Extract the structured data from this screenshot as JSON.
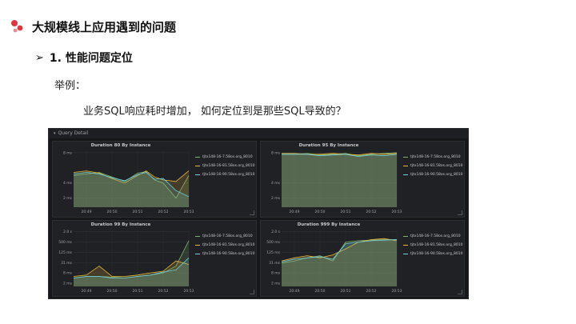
{
  "slide": {
    "title": "大规模线上应用遇到的问题",
    "bullet_arrow": "➢",
    "bullet": "1. 性能问题定位",
    "example_label": "举例：",
    "question": "业务SQL响应耗时增加， 如何定位到是那些SQL导致的？"
  },
  "dashboard": {
    "header_caret": "▾",
    "header": "Query Detail",
    "colors": {
      "series1": "#7eb26d",
      "series2": "#eab839",
      "series3": "#6ed0e0"
    }
  },
  "chart_data": [
    {
      "type": "area",
      "title": "Duration 80 By Instance",
      "y_ticks": [
        "8 ms",
        "4 ms",
        "2 ms"
      ],
      "x_ticks": [
        "20:49",
        "20:50",
        "20:51",
        "20:52",
        "20:53"
      ],
      "legend_entries": [
        "tjtx148-16-7.58os.org_8010",
        "tjtx148-16-81.58os.org_8010",
        "tjtx148-16-90.58os.org_8010"
      ],
      "series": [
        {
          "name": "tjtx148-16-7.58os.org_8010",
          "x": [
            "20:48:30",
            "20:49",
            "20:49:30",
            "20:50",
            "20:50:30",
            "20:51",
            "20:51:20",
            "20:51:40",
            "20:52",
            "20:52:30",
            "20:53"
          ],
          "values": [
            5.0,
            5.2,
            5.4,
            4.8,
            4.2,
            5.3,
            5.5,
            4.4,
            4.0,
            2.0,
            5.0
          ]
        },
        {
          "name": "tjtx148-16-81.58os.org_8010",
          "x": [
            "20:48:30",
            "20:49",
            "20:49:30",
            "20:50",
            "20:50:30",
            "20:51",
            "20:51:20",
            "20:51:40",
            "20:52",
            "20:52:30",
            "20:53"
          ],
          "values": [
            5.4,
            5.6,
            5.3,
            4.6,
            4.0,
            5.0,
            5.6,
            4.8,
            4.4,
            4.2,
            5.6
          ]
        },
        {
          "name": "tjtx148-16-90.58os.org_8010",
          "x": [
            "20:48:30",
            "20:49",
            "20:49:30",
            "20:50",
            "20:50:30",
            "20:51",
            "20:51:20",
            "20:51:40",
            "20:52",
            "20:52:30",
            "20:53"
          ],
          "values": [
            5.2,
            5.4,
            5.2,
            4.7,
            4.3,
            5.1,
            5.4,
            4.5,
            4.6,
            3.0,
            2.2
          ]
        }
      ]
    },
    {
      "type": "area",
      "title": "Duration 95 By Instance",
      "y_ticks": [
        "8 ms",
        "4 ms",
        "2 ms"
      ],
      "x_ticks": [
        "20:49",
        "20:50",
        "20:51",
        "20:52",
        "20:53"
      ],
      "legend_entries": [
        "tjtx148-16-7.58os.org_8010",
        "tjtx148-16-81.58os.org_8010",
        "tjtx148-16-90.58os.org_8010"
      ],
      "series": [
        {
          "name": "tjtx148-16-7.58os.org_8010",
          "x": [
            "20:48:30",
            "20:49",
            "20:49:30",
            "20:50",
            "20:50:30",
            "20:51",
            "20:51:30",
            "20:52",
            "20:52:30",
            "20:53"
          ],
          "values": [
            7.8,
            7.8,
            7.9,
            7.7,
            7.8,
            7.9,
            7.6,
            7.8,
            7.9,
            8.0
          ]
        },
        {
          "name": "tjtx148-16-81.58os.org_8010",
          "x": [
            "20:48:30",
            "20:49",
            "20:49:30",
            "20:50",
            "20:50:30",
            "20:51",
            "20:51:30",
            "20:52",
            "20:52:30",
            "20:53"
          ],
          "values": [
            7.9,
            7.9,
            7.8,
            7.8,
            7.9,
            7.8,
            7.7,
            7.9,
            7.8,
            7.9
          ]
        },
        {
          "name": "tjtx148-16-90.58os.org_8010",
          "x": [
            "20:48:30",
            "20:49",
            "20:49:30",
            "20:50",
            "20:50:30",
            "20:51",
            "20:51:30",
            "20:52",
            "20:52:30",
            "20:53"
          ],
          "values": [
            7.8,
            7.8,
            7.8,
            7.6,
            7.7,
            7.8,
            7.5,
            7.7,
            7.6,
            7.8
          ]
        }
      ]
    },
    {
      "type": "area",
      "title": "Duration 99 By Instance",
      "y_ticks": [
        "2.0 s",
        "500 ms",
        "125 ms",
        "31 ms",
        "8 ms",
        "2 ms"
      ],
      "x_ticks": [
        "20:49",
        "20:50",
        "20:51",
        "20:52",
        "20:53"
      ],
      "legend_entries": [
        "tjtx148-16-7.58os.org_8010",
        "tjtx148-16-81.58os.org_8010",
        "tjtx148-16-90.58os.org_8010"
      ],
      "series": [
        {
          "name": "tjtx148-16-7.58os.org_8010",
          "x": [
            "20:48:30",
            "20:49",
            "20:49:30",
            "20:50",
            "20:50:30",
            "20:51",
            "20:51:30",
            "20:52",
            "20:52:30",
            "20:53"
          ],
          "values": [
            4,
            5,
            5,
            4.5,
            4,
            5,
            6,
            8,
            20,
            600
          ]
        },
        {
          "name": "tjtx148-16-81.58os.org_8010",
          "x": [
            "20:48:30",
            "20:49",
            "20:49:30",
            "20:50",
            "20:50:30",
            "20:51",
            "20:51:30",
            "20:52",
            "20:52:30",
            "20:53"
          ],
          "values": [
            5,
            6,
            20,
            5,
            5,
            6,
            8,
            10,
            40,
            25
          ]
        },
        {
          "name": "tjtx148-16-90.58os.org_8010",
          "x": [
            "20:48:30",
            "20:49",
            "20:49:30",
            "20:50",
            "20:50:30",
            "20:51",
            "20:51:30",
            "20:52",
            "20:52:30",
            "20:53"
          ],
          "values": [
            4,
            5,
            5,
            4,
            4,
            5,
            6,
            9,
            12,
            60
          ]
        }
      ]
    },
    {
      "type": "area",
      "title": "Duration 999 By Instance",
      "y_ticks": [
        "2.0 s",
        "500 ms",
        "125 ms",
        "31 ms",
        "8 ms",
        "2 ms"
      ],
      "x_ticks": [
        "20:49",
        "20:50",
        "20:51",
        "20:52",
        "20:53"
      ],
      "legend_entries": [
        "tjtx148-16-7.58os.org_8010",
        "tjtx148-16-81.58os.org_8010",
        "tjtx148-16-90.58os.org_8010"
      ],
      "series": [
        {
          "name": "tjtx148-16-7.58os.org_8010",
          "x": [
            "20:48:30",
            "20:49",
            "20:49:30",
            "20:50",
            "20:50:30",
            "20:51",
            "20:51:30",
            "20:52",
            "20:52:30",
            "20:53"
          ],
          "values": [
            30,
            40,
            60,
            80,
            40,
            500,
            600,
            650,
            700,
            700
          ]
        },
        {
          "name": "tjtx148-16-81.58os.org_8010",
          "x": [
            "20:48:30",
            "20:49",
            "20:49:30",
            "20:50",
            "20:50:30",
            "20:51",
            "20:51:30",
            "20:52",
            "20:52:30",
            "20:53"
          ],
          "values": [
            40,
            60,
            80,
            60,
            90,
            200,
            500,
            700,
            800,
            600
          ]
        },
        {
          "name": "tjtx148-16-90.58os.org_8010",
          "x": [
            "20:48:30",
            "20:49",
            "20:49:30",
            "20:50",
            "20:50:30",
            "20:51",
            "20:51:30",
            "20:52",
            "20:52:30",
            "20:53"
          ],
          "values": [
            35,
            50,
            60,
            70,
            50,
            400,
            500,
            600,
            650,
            700
          ]
        }
      ]
    }
  ]
}
